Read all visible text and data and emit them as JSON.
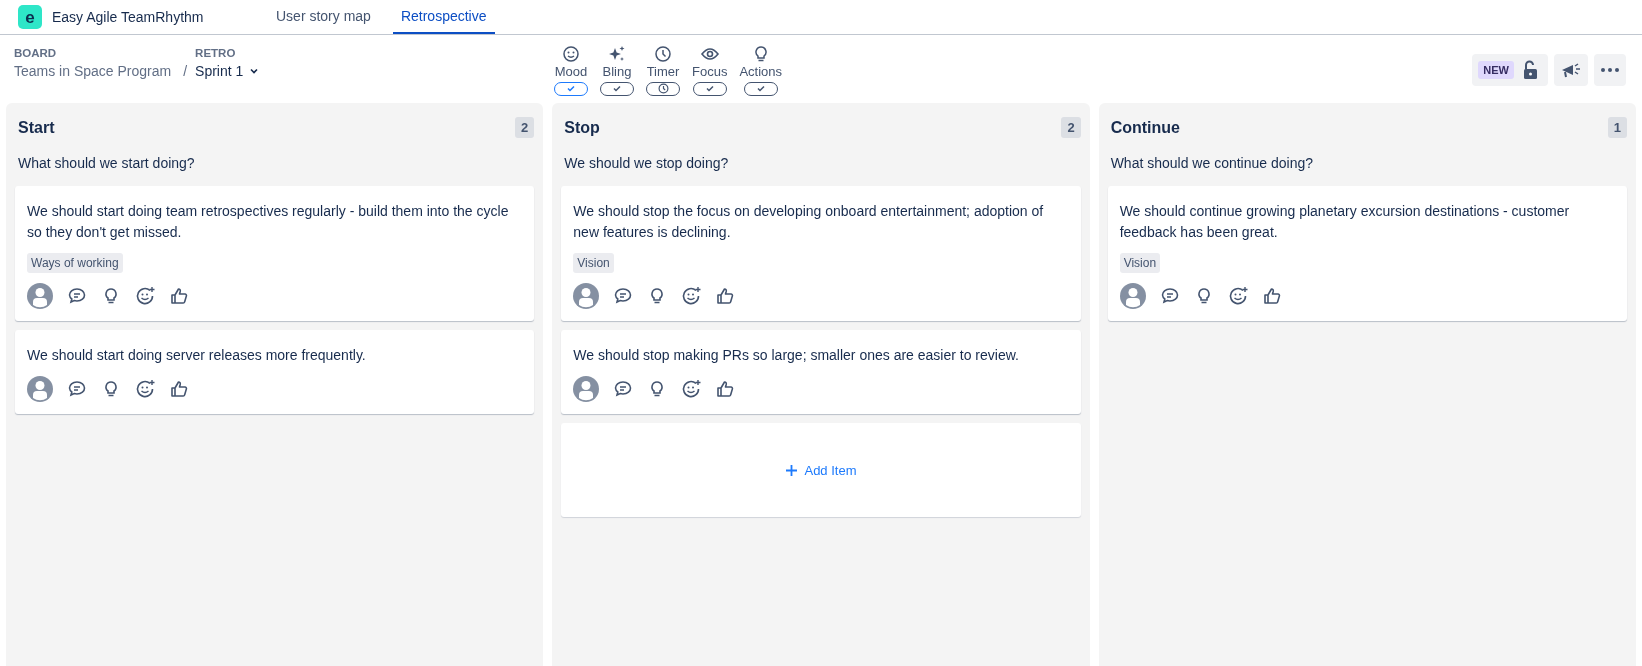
{
  "app": {
    "name": "Easy Agile TeamRhythm",
    "logo_letter": "e"
  },
  "tabs": [
    {
      "label": "User story map",
      "selected": false
    },
    {
      "label": "Retrospective",
      "selected": true
    }
  ],
  "breadcrumb": {
    "board_label": "BOARD",
    "board": "Teams in Space Program",
    "separator": "/",
    "retro_label": "RETRO",
    "retro": "Sprint 1"
  },
  "features": [
    {
      "label": "Mood",
      "kind": "check",
      "selected": true
    },
    {
      "label": "Bling",
      "kind": "check",
      "selected": false
    },
    {
      "label": "Timer",
      "kind": "clock",
      "selected": false
    },
    {
      "label": "Focus",
      "kind": "check",
      "selected": false
    },
    {
      "label": "Actions",
      "kind": "check",
      "selected": false
    }
  ],
  "toolbar": {
    "new_badge": "NEW"
  },
  "columns": [
    {
      "title": "Start",
      "count": "2",
      "prompt": "What should we start doing?",
      "cards": [
        {
          "text": "We should start doing team retrospectives regularly - build them into the cycle so they don't get missed.",
          "tag": "Ways of working"
        },
        {
          "text": "We should start doing server releases more frequently."
        }
      ]
    },
    {
      "title": "Stop",
      "count": "2",
      "prompt": "We should we stop doing?",
      "add_item": "Add Item",
      "cards": [
        {
          "text": "We should stop the focus on developing onboard entertainment; adoption of new features is declining.",
          "tag": "Vision"
        },
        {
          "text": "We should stop making PRs so large; smaller ones are easier to review."
        }
      ]
    },
    {
      "title": "Continue",
      "count": "1",
      "prompt": "What should we continue doing?",
      "cards": [
        {
          "text": "We should continue growing planetary excursion destinations - customer feedback has been great.",
          "tag": "Vision"
        }
      ]
    }
  ]
}
